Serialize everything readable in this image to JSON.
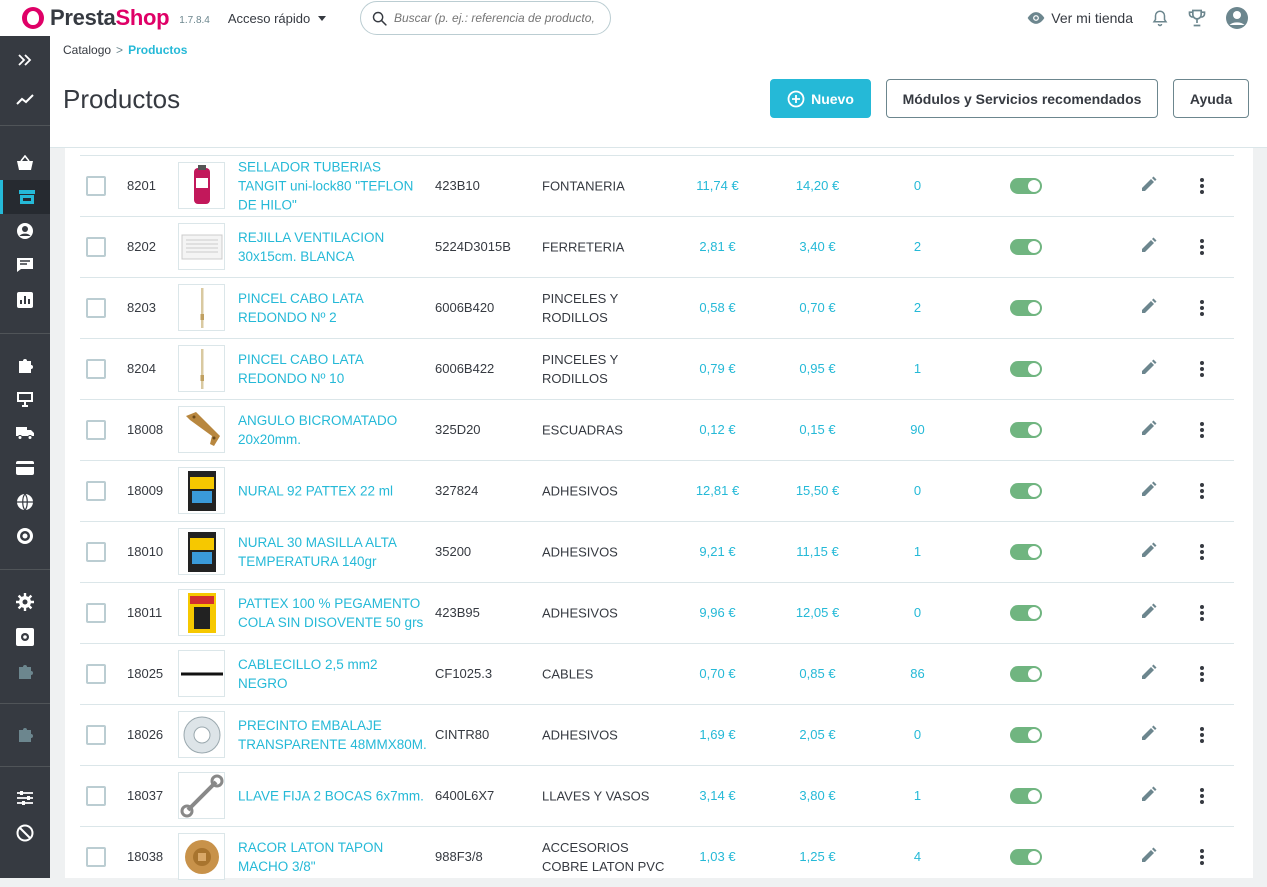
{
  "topbar": {
    "logo_presta": "Presta",
    "logo_shop": "Shop",
    "version": "1.7.8.4",
    "quick_access": "Acceso rápido",
    "search_placeholder": "Buscar (p. ej.: referencia de producto,",
    "view_store": "Ver mi tienda"
  },
  "header": {
    "breadcrumb_parent": "Catalogo",
    "breadcrumb_separator": ">",
    "breadcrumb_current": "Productos",
    "title": "Productos",
    "btn_new": "Nuevo",
    "btn_modules": "Módulos y Servicios recomendados",
    "btn_help": "Ayuda"
  },
  "sidebar_icons": [
    "expand-icon",
    "dashboard-icon",
    "orders-icon",
    "catalog-icon",
    "customers-icon",
    "messages-icon",
    "stats-icon",
    "modules-icon",
    "design-icon",
    "shipping-icon",
    "payment-icon",
    "international-icon",
    "marketing-icon",
    "settings-icon",
    "advanced-settings-icon",
    "extensions-icon",
    "puzzle-icon",
    "filters-icon",
    "block-icon"
  ],
  "products": [
    {
      "id": "8201",
      "name": "SELLADOR TUBERIAS TANGIT uni-lock80 \"TEFLON DE HILO\"",
      "ref": "423B10",
      "category": "FONTANERIA",
      "price_ex": "11,74 €",
      "price_inc": "14,20 €",
      "qty": "0",
      "thumb": "tube"
    },
    {
      "id": "8202",
      "name": "REJILLA VENTILACION 30x15cm. BLANCA",
      "ref": "5224D3015B",
      "category": "FERRETERIA",
      "price_ex": "2,81 €",
      "price_inc": "3,40 €",
      "qty": "2",
      "thumb": "grille"
    },
    {
      "id": "8203",
      "name": "PINCEL CABO LATA REDONDO Nº 2",
      "ref": "6006B420",
      "category": "PINCELES Y RODILLOS",
      "price_ex": "0,58 €",
      "price_inc": "0,70 €",
      "qty": "2",
      "thumb": "brush"
    },
    {
      "id": "8204",
      "name": "PINCEL CABO LATA REDONDO Nº 10",
      "ref": "6006B422",
      "category": "PINCELES Y RODILLOS",
      "price_ex": "0,79 €",
      "price_inc": "0,95 €",
      "qty": "1",
      "thumb": "brush"
    },
    {
      "id": "18008",
      "name": "ANGULO BICROMATADO 20x20mm.",
      "ref": "325D20",
      "category": "ESCUADRAS",
      "price_ex": "0,12 €",
      "price_inc": "0,15 €",
      "qty": "90",
      "thumb": "angle"
    },
    {
      "id": "18009",
      "name": "NURAL 92 PATTEX 22 ml",
      "ref": "327824",
      "category": "ADHESIVOS",
      "price_ex": "12,81 €",
      "price_inc": "15,50 €",
      "qty": "0",
      "thumb": "pack"
    },
    {
      "id": "18010",
      "name": "NURAL 30 MASILLA ALTA TEMPERATURA 140gr",
      "ref": "35200",
      "category": "ADHESIVOS",
      "price_ex": "9,21 €",
      "price_inc": "11,15 €",
      "qty": "1",
      "thumb": "pack"
    },
    {
      "id": "18011",
      "name": "PATTEX 100 % PEGAMENTO COLA SIN DISOVENTE 50 grs",
      "ref": "423B95",
      "category": "ADHESIVOS",
      "price_ex": "9,96 €",
      "price_inc": "12,05 €",
      "qty": "0",
      "thumb": "pattex"
    },
    {
      "id": "18025",
      "name": "CABLECILLO 2,5 mm2 NEGRO",
      "ref": "CF1025.3",
      "category": "CABLES",
      "price_ex": "0,70 €",
      "price_inc": "0,85 €",
      "qty": "86",
      "thumb": "cable"
    },
    {
      "id": "18026",
      "name": "PRECINTO EMBALAJE TRANSPARENTE 48MMX80M.",
      "ref": "CINTR80",
      "category": "ADHESIVOS",
      "price_ex": "1,69 €",
      "price_inc": "2,05 €",
      "qty": "0",
      "thumb": "tape"
    },
    {
      "id": "18037",
      "name": "LLAVE FIJA 2 BOCAS 6x7mm.",
      "ref": "6400L6X7",
      "category": "LLAVES Y VASOS",
      "price_ex": "3,14 €",
      "price_inc": "3,80 €",
      "qty": "1",
      "thumb": "wrench"
    },
    {
      "id": "18038",
      "name": "RACOR LATON TAPON MACHO 3/8\"",
      "ref": "988F3/8",
      "category": "ACCESORIOS COBRE LATON PVC",
      "price_ex": "1,03 €",
      "price_inc": "1,25 €",
      "qty": "4",
      "thumb": "brass"
    }
  ]
}
